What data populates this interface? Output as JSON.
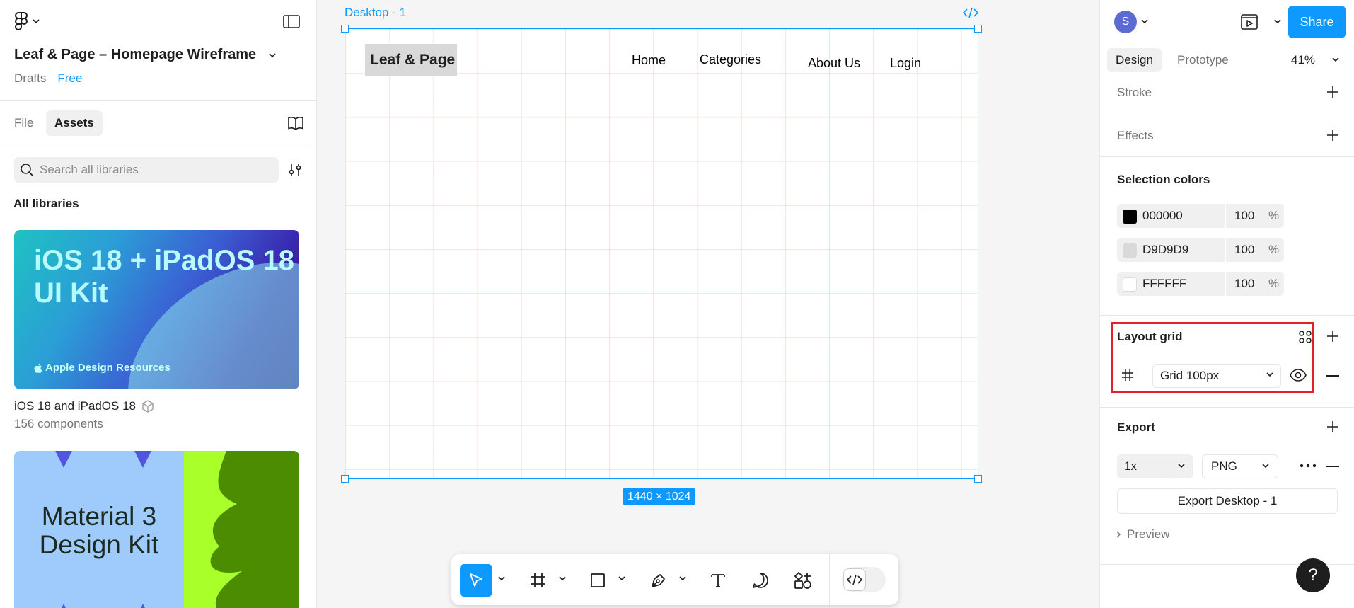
{
  "left": {
    "file_name": "Leaf & Page – Homepage Wireframe",
    "location": "Drafts",
    "plan": "Free",
    "tabs": {
      "file": "File",
      "assets": "Assets"
    },
    "search_placeholder": "Search all libraries",
    "all_libraries": "All libraries",
    "libraries": [
      {
        "card_title": "iOS 18 + iPadOS 18 UI Kit",
        "card_subtitle": "Apple Design Resources",
        "name": "iOS 18 and iPadOS 18",
        "count": "156 components"
      },
      {
        "card_title": "Material 3 Design Kit"
      }
    ]
  },
  "canvas": {
    "frame_label": "Desktop - 1",
    "size_badge": "1440 × 1024",
    "wireframe": {
      "logo": "Leaf & Page",
      "nav": [
        "Home",
        "Categories",
        "About Us",
        "Login"
      ]
    }
  },
  "toolbar": {
    "tools": [
      "move-icon",
      "frame-icon",
      "rectangle-icon",
      "pen-icon",
      "text-icon",
      "comment-icon",
      "actions-icon",
      "dev-mode-icon"
    ]
  },
  "right": {
    "avatar_initial": "S",
    "share": "Share",
    "tabs": {
      "design": "Design",
      "prototype": "Prototype"
    },
    "zoom": "41%",
    "stroke": "Stroke",
    "effects": "Effects",
    "selection_colors_title": "Selection colors",
    "selection_colors": [
      {
        "hex": "000000",
        "opacity": "100",
        "pct": "%",
        "swatch": "#000000"
      },
      {
        "hex": "D9D9D9",
        "opacity": "100",
        "pct": "%",
        "swatch": "#D9D9D9"
      },
      {
        "hex": "FFFFFF",
        "opacity": "100",
        "pct": "%",
        "swatch": "#FFFFFF"
      }
    ],
    "layout_grid_title": "Layout grid",
    "layout_grid_value": "Grid 100px",
    "export_title": "Export",
    "export_scale": "1x",
    "export_format": "PNG",
    "export_button": "Export Desktop - 1",
    "preview": "Preview"
  },
  "help": "?",
  "colors": {
    "accent": "#0d99ff",
    "highlight": "#e0202a",
    "grid": "#ff7878"
  }
}
